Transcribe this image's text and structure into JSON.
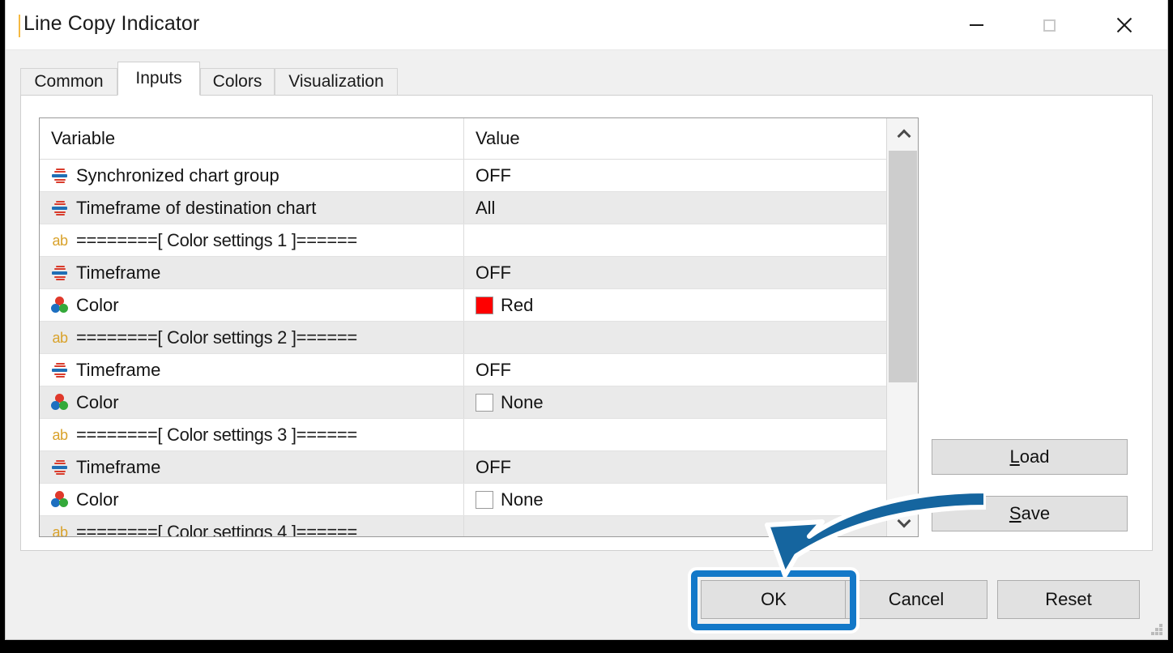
{
  "window": {
    "title": "Line Copy Indicator",
    "controls": {
      "minimize": "minimize-icon",
      "maximize": "maximize-icon",
      "close": "close-icon"
    }
  },
  "tabs": [
    {
      "label": "Common",
      "selected": false
    },
    {
      "label": "Inputs",
      "selected": true
    },
    {
      "label": "Colors",
      "selected": false
    },
    {
      "label": "Visualization",
      "selected": false
    }
  ],
  "grid": {
    "headers": {
      "variable": "Variable",
      "value": "Value"
    },
    "rows": [
      {
        "icon": "timeframe-icon",
        "variable": "Synchronized chart group",
        "value": "OFF",
        "swatch": null
      },
      {
        "icon": "timeframe-icon",
        "variable": "Timeframe of destination chart",
        "value": "All",
        "swatch": null
      },
      {
        "icon": "text-ab-icon",
        "variable": "========[ Color settings 1 ]======",
        "value": "",
        "swatch": null
      },
      {
        "icon": "timeframe-icon",
        "variable": "Timeframe",
        "value": "OFF",
        "swatch": null
      },
      {
        "icon": "rgb-color-icon",
        "variable": "Color",
        "value": "Red",
        "swatch": "#ff0000"
      },
      {
        "icon": "text-ab-icon",
        "variable": "========[ Color settings 2 ]======",
        "value": "",
        "swatch": null
      },
      {
        "icon": "timeframe-icon",
        "variable": "Timeframe",
        "value": "OFF",
        "swatch": null
      },
      {
        "icon": "rgb-color-icon",
        "variable": "Color",
        "value": "None",
        "swatch": "#ffffff"
      },
      {
        "icon": "text-ab-icon",
        "variable": "========[ Color settings 3 ]======",
        "value": "",
        "swatch": null
      },
      {
        "icon": "timeframe-icon",
        "variable": "Timeframe",
        "value": "OFF",
        "swatch": null
      },
      {
        "icon": "rgb-color-icon",
        "variable": "Color",
        "value": "None",
        "swatch": "#ffffff"
      },
      {
        "icon": "text-ab-icon",
        "variable": "========[ Color settings 4 ]======",
        "value": "",
        "swatch": null
      }
    ]
  },
  "scrollbar": {
    "up_arrow": "chevron-up-icon",
    "down_arrow": "chevron-down-icon"
  },
  "side_buttons": {
    "load": {
      "accel": "L",
      "rest": "oad"
    },
    "save": {
      "accel": "S",
      "rest": "ave"
    }
  },
  "footer_buttons": {
    "ok": "OK",
    "cancel": "Cancel",
    "reset": "Reset"
  },
  "annotations": {
    "highlight_color": "#1378c8",
    "arrow_color": "#15659f",
    "arrow_target": "ok-button"
  }
}
